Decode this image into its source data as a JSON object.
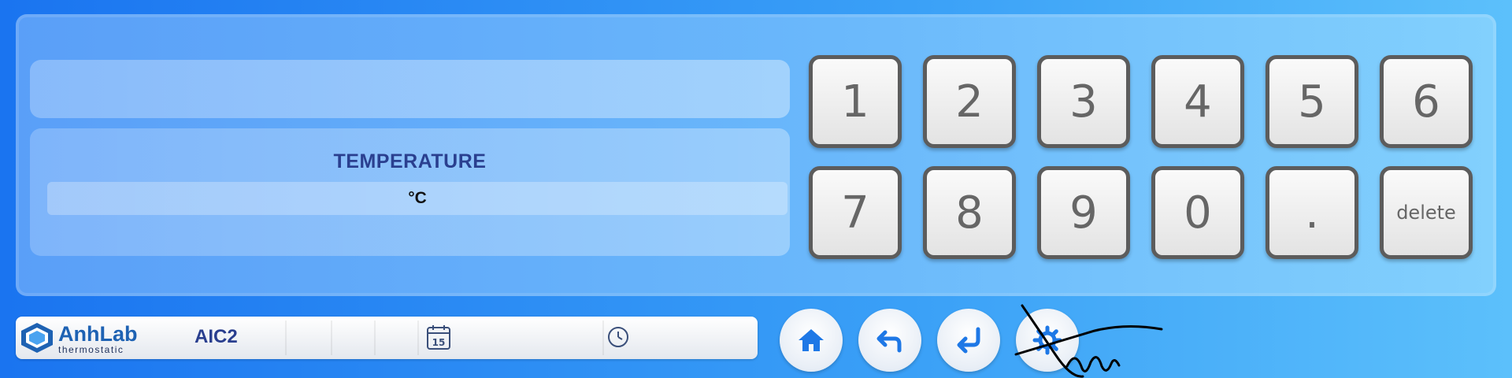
{
  "app": {
    "logo_text": "AnhLab",
    "logo_sub": "thermostatic",
    "device_name": "AIC2"
  },
  "input": {
    "top_value": ""
  },
  "temperature": {
    "title": "TEMPERATURE",
    "unit": "°C"
  },
  "keypad": {
    "row1": [
      "1",
      "2",
      "3",
      "4",
      "5",
      "6"
    ],
    "row2": [
      "7",
      "8",
      "9",
      "0",
      ".",
      "delete"
    ]
  },
  "calendar": {
    "day": "15"
  },
  "icons": {
    "calendar": "calendar-icon",
    "clock": "clock-icon",
    "home": "home-icon",
    "back": "undo-icon",
    "enter": "enter-icon",
    "settings": "gear-icon"
  },
  "colors": {
    "accent": "#1e62b3",
    "title": "#2a3f8f",
    "background": "#1a74f0"
  }
}
